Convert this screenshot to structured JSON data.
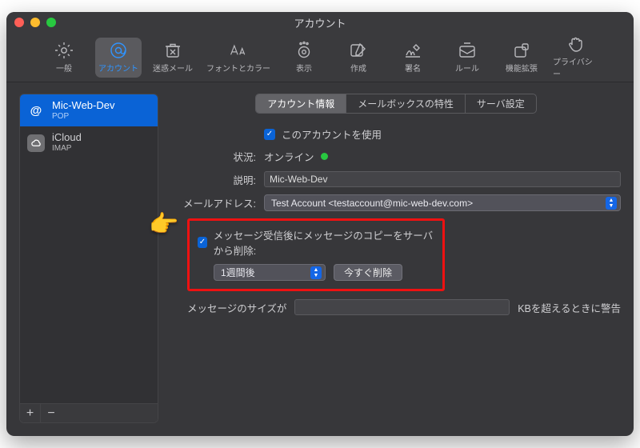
{
  "window": {
    "title": "アカウント"
  },
  "toolbar": {
    "items": [
      {
        "label": "一般",
        "icon": "gear"
      },
      {
        "label": "アカウント",
        "icon": "at",
        "active": true
      },
      {
        "label": "迷惑メール",
        "icon": "bin"
      },
      {
        "label": "フォントとカラー",
        "icon": "aa",
        "wide": true
      },
      {
        "label": "表示",
        "icon": "eye-dots"
      },
      {
        "label": "作成",
        "icon": "compose"
      },
      {
        "label": "署名",
        "icon": "signature"
      },
      {
        "label": "ルール",
        "icon": "rules"
      },
      {
        "label": "機能拡張",
        "icon": "extension"
      },
      {
        "label": "プライバシー",
        "icon": "hand"
      }
    ]
  },
  "sidebar": {
    "accounts": [
      {
        "name": "Mic-Web-Dev",
        "proto": "POP",
        "icon": "at",
        "selected": true
      },
      {
        "name": "iCloud",
        "proto": "IMAP",
        "icon": "cloud",
        "selected": false
      }
    ],
    "add": "+",
    "remove": "−"
  },
  "tabs": {
    "items": [
      "アカウント情報",
      "メールボックスの特性",
      "サーバ設定"
    ],
    "activeIndex": 0
  },
  "form": {
    "enable_label": "このアカウントを使用",
    "status_label": "状況:",
    "status_value": "オンライン",
    "desc_label": "説明:",
    "desc_value": "Mic-Web-Dev",
    "email_label": "メールアドレス:",
    "email_value": "Test Account <testaccount@mic-web-dev.com>",
    "remove_label": "メッセージ受信後にメッセージのコピーをサーバから削除:",
    "remove_after": "1週間後",
    "remove_now": "今すぐ削除",
    "size_label": "メッセージのサイズが",
    "size_suffix": "KBを超えるときに警告"
  }
}
